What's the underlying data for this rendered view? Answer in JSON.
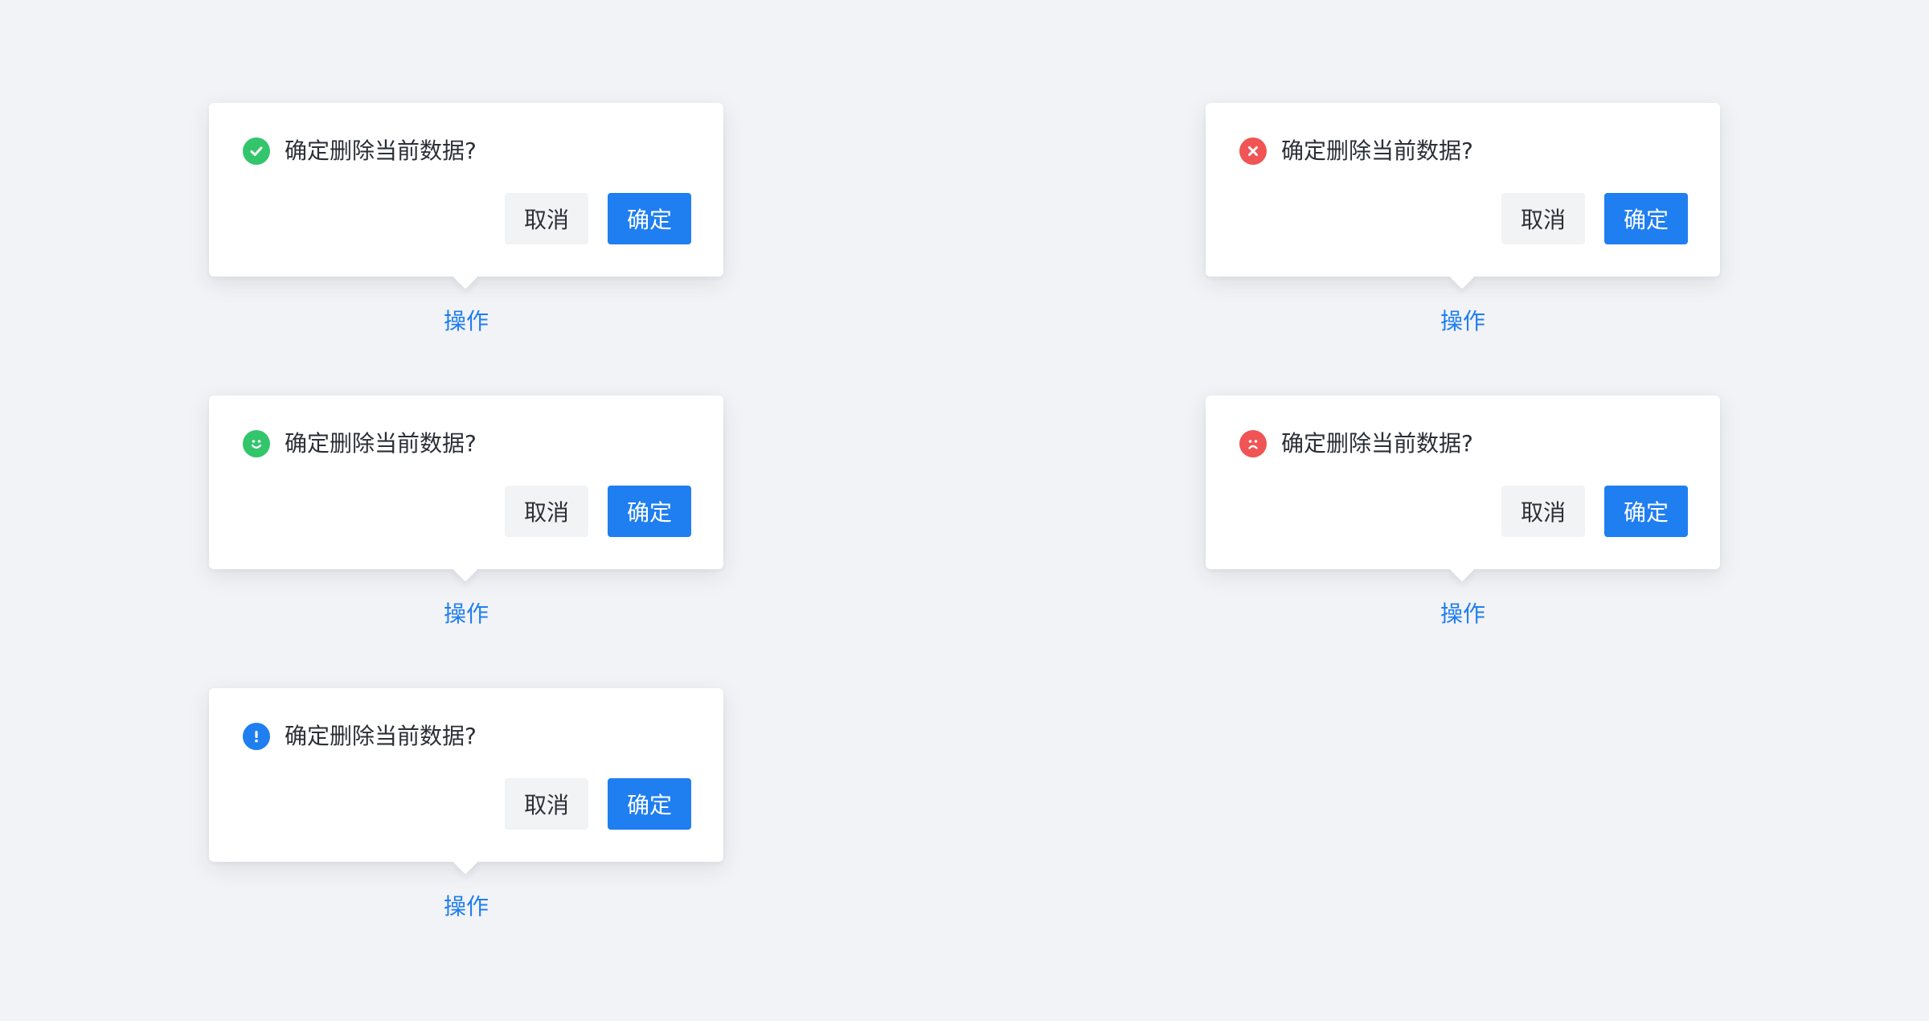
{
  "colors": {
    "background": "#f2f3f6",
    "success": "#33c56b",
    "error": "#f05454",
    "info": "#1f7ef0",
    "primary": "#1f7ef0",
    "text": "#2b2f36",
    "cancel_bg": "#f2f3f5"
  },
  "popconfirms": [
    {
      "icon": "check-circle-icon",
      "icon_color": "#33c56b",
      "message": "确定删除当前数据?",
      "cancel_label": "取消",
      "confirm_label": "确定",
      "trigger_label": "操作"
    },
    {
      "icon": "close-circle-icon",
      "icon_color": "#f05454",
      "message": "确定删除当前数据?",
      "cancel_label": "取消",
      "confirm_label": "确定",
      "trigger_label": "操作"
    },
    {
      "icon": "smile-icon",
      "icon_color": "#33c56b",
      "message": "确定删除当前数据?",
      "cancel_label": "取消",
      "confirm_label": "确定",
      "trigger_label": "操作"
    },
    {
      "icon": "frown-icon",
      "icon_color": "#f05454",
      "message": "确定删除当前数据?",
      "cancel_label": "取消",
      "confirm_label": "确定",
      "trigger_label": "操作"
    },
    {
      "icon": "exclamation-circle-icon",
      "icon_color": "#1f7ef0",
      "message": "确定删除当前数据?",
      "cancel_label": "取消",
      "confirm_label": "确定",
      "trigger_label": "操作"
    }
  ]
}
